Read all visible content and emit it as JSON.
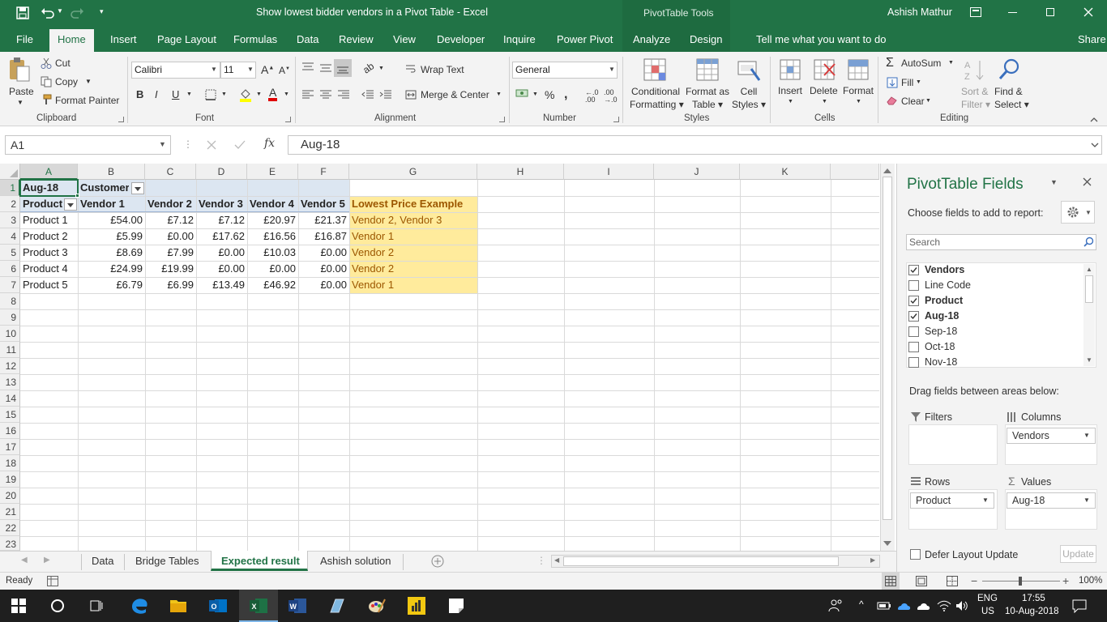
{
  "titlebar": {
    "title": "Show lowest bidder vendors in a Pivot Table  -  Excel",
    "context_tools": "PivotTable Tools",
    "user": "Ashish Mathur"
  },
  "tabs": [
    "File",
    "Home",
    "Insert",
    "Page Layout",
    "Formulas",
    "Data",
    "Review",
    "View",
    "Developer",
    "Inquire",
    "Power Pivot",
    "Analyze",
    "Design"
  ],
  "tell_me": "Tell me what you want to do",
  "share": "Share",
  "ribbon": {
    "clipboard": {
      "paste": "Paste",
      "cut": "Cut",
      "copy": "Copy",
      "format_painter": "Format Painter",
      "label": "Clipboard"
    },
    "font": {
      "name": "Calibri",
      "size": "11",
      "label": "Font"
    },
    "alignment": {
      "wrap": "Wrap Text",
      "merge": "Merge & Center",
      "label": "Alignment"
    },
    "number": {
      "format": "General",
      "label": "Number"
    },
    "styles": {
      "cond1": "Conditional",
      "cond2": "Formatting",
      "fmt1": "Format as",
      "fmt2": "Table",
      "cell1": "Cell",
      "cell2": "Styles",
      "label": "Styles"
    },
    "cells": {
      "insert": "Insert",
      "delete": "Delete",
      "format": "Format",
      "label": "Cells"
    },
    "editing": {
      "autosum": "AutoSum",
      "fill": "Fill",
      "clear": "Clear",
      "sort1": "Sort &",
      "sort2": "Filter",
      "find1": "Find &",
      "find2": "Select",
      "label": "Editing"
    }
  },
  "formula_bar": {
    "name_box": "A1",
    "content": "Aug-18"
  },
  "sheet": {
    "columns": [
      "A",
      "B",
      "C",
      "D",
      "E",
      "F",
      "G",
      "H",
      "I",
      "J",
      "K"
    ],
    "rows": [
      "1",
      "2",
      "3",
      "4",
      "5",
      "6",
      "7",
      "8",
      "9",
      "10",
      "11",
      "12",
      "13",
      "14",
      "15",
      "16",
      "17",
      "18",
      "19",
      "20",
      "21",
      "22",
      "23"
    ],
    "a1": "Aug-18",
    "b1": "Customer",
    "headers": [
      "Product",
      "Vendor 1",
      "Vendor 2",
      "Vendor 3",
      "Vendor 4",
      "Vendor 5",
      "Lowest Price Example"
    ],
    "data": [
      [
        "Product 1",
        "£54.00",
        "£7.12",
        "£7.12",
        "£20.97",
        "£21.37",
        "Vendor 2, Vendor 3"
      ],
      [
        "Product 2",
        "£5.99",
        "£0.00",
        "£17.62",
        "£16.56",
        "£16.87",
        "Vendor 1"
      ],
      [
        "Product 3",
        "£8.69",
        "£7.99",
        "£0.00",
        "£10.03",
        "£0.00",
        "Vendor 2"
      ],
      [
        "Product 4",
        "£24.99",
        "£19.99",
        "£0.00",
        "£0.00",
        "£0.00",
        "Vendor 2"
      ],
      [
        "Product 5",
        "£6.79",
        "£6.99",
        "£13.49",
        "£46.92",
        "£0.00",
        "Vendor 1"
      ]
    ]
  },
  "sheet_tabs": [
    "Data",
    "Bridge Tables",
    "Expected result",
    "Ashish solution"
  ],
  "active_sheet": "Expected result",
  "status": {
    "ready": "Ready",
    "zoom": "100%"
  },
  "pivot_panel": {
    "title": "PivotTable Fields",
    "subtitle": "Choose fields to add to report:",
    "search": "Search",
    "fields": [
      {
        "name": "Vendors",
        "checked": true
      },
      {
        "name": "Line Code",
        "checked": false
      },
      {
        "name": "Product",
        "checked": true
      },
      {
        "name": "Aug-18",
        "checked": true
      },
      {
        "name": "Sep-18",
        "checked": false
      },
      {
        "name": "Oct-18",
        "checked": false
      },
      {
        "name": "Nov-18",
        "checked": false
      }
    ],
    "drag_text": "Drag fields between areas below:",
    "filters": "Filters",
    "columns": "Columns",
    "rows": "Rows",
    "values": "Values",
    "columns_value": "Vendors",
    "rows_value": "Product",
    "values_value": "Aug-18",
    "defer": "Defer Layout Update",
    "update": "Update"
  },
  "taskbar": {
    "lang1": "ENG",
    "lang2": "US",
    "time": "17:55",
    "date": "10-Aug-2018"
  }
}
